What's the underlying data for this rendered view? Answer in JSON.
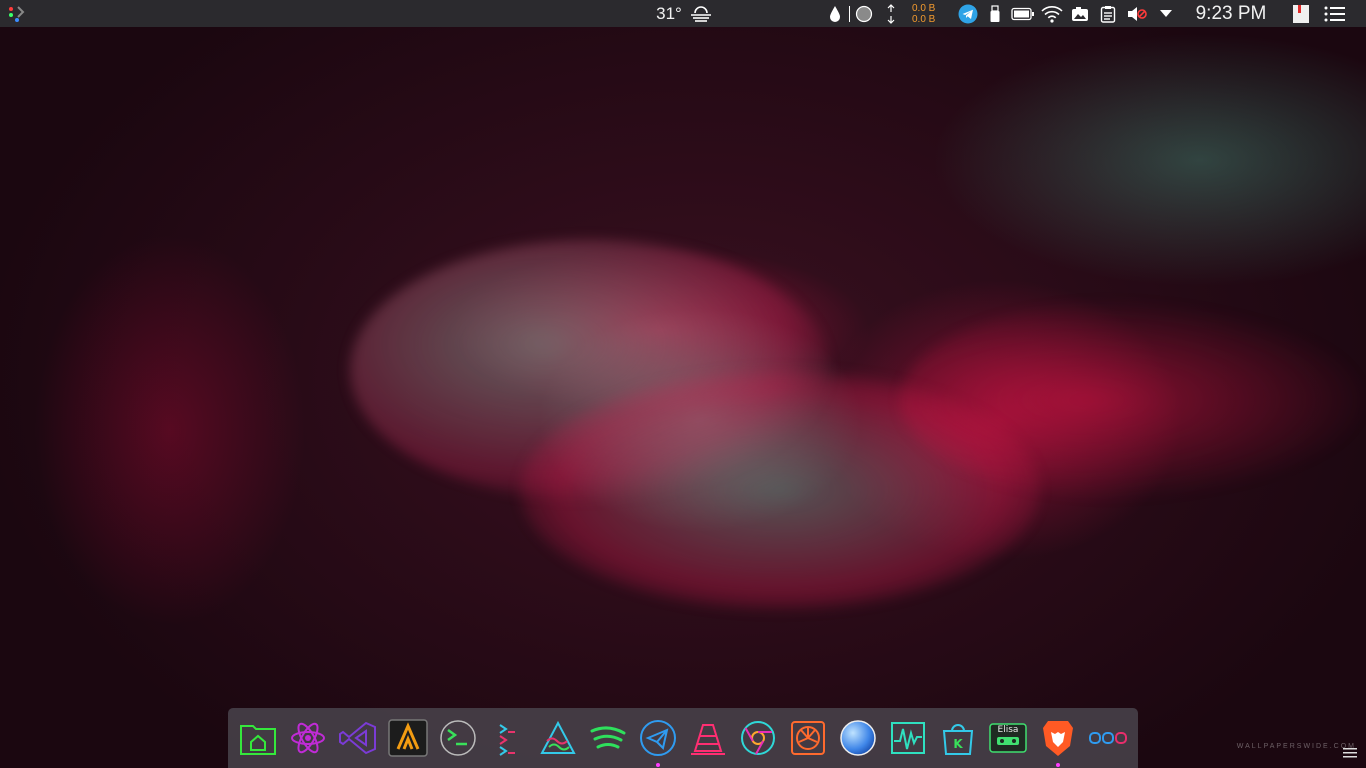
{
  "topbar": {
    "temperature": "31°",
    "net_up": "0.0 B",
    "net_down": "0.0 B",
    "clock": "9:23 PM",
    "icons": [
      "apps-launcher-icon",
      "weather-fog-icon",
      "droplet-icon",
      "record-icon",
      "network-arrows-icon",
      "telegram-icon",
      "usb-icon",
      "battery-icon",
      "wifi-icon",
      "screenshot-icon",
      "clipboard-icon",
      "volume-muted-icon",
      "dropdown-arrow-icon",
      "notes-icon",
      "menu-lines-icon"
    ]
  },
  "dock": {
    "apps": [
      {
        "name": "files",
        "icon": "home-folder-icon",
        "color": "#35e83c",
        "running": false
      },
      {
        "name": "atom",
        "icon": "atom-icon",
        "color": "#c02bd6",
        "running": false
      },
      {
        "name": "visual-studio",
        "icon": "visual-studio-icon",
        "color": "#7b3bd6",
        "running": false
      },
      {
        "name": "alacritty",
        "icon": "alacritty-icon",
        "color": "#f39c12",
        "running": false
      },
      {
        "name": "terminal",
        "icon": "terminal-icon",
        "color": "#39e05a",
        "running": false
      },
      {
        "name": "git",
        "icon": "git-icon",
        "color": "#e8336c",
        "running": false
      },
      {
        "name": "kdenlive",
        "icon": "wave-tent-icon",
        "color": "#33c9e8",
        "running": false
      },
      {
        "name": "spotify",
        "icon": "spotify-icon",
        "color": "#2ee05c",
        "running": false
      },
      {
        "name": "telegram",
        "icon": "telegram-icon",
        "color": "#2f9bf0",
        "running": true
      },
      {
        "name": "vlc",
        "icon": "vlc-cone-icon",
        "color": "#ff2e72",
        "running": false
      },
      {
        "name": "chromium",
        "icon": "chromium-icon",
        "color": "#2fd7d7",
        "running": false
      },
      {
        "name": "fan-control",
        "icon": "fan-icon",
        "color": "#ff6a2e",
        "running": false
      },
      {
        "name": "marble",
        "icon": "globe-icon",
        "color": "#2f7de8",
        "running": false
      },
      {
        "name": "system-monitor",
        "icon": "activity-monitor-icon",
        "color": "#2fe0c0",
        "running": false
      },
      {
        "name": "kde-store",
        "icon": "store-bag-icon",
        "color": "#33c9e8",
        "running": false
      },
      {
        "name": "elisa",
        "icon": "cassette-icon",
        "color": "#40e070",
        "running": false
      },
      {
        "name": "brave",
        "icon": "brave-lion-icon",
        "color": "#ff5a24",
        "running": true
      },
      {
        "name": "ooo",
        "icon": "ooo-icon",
        "color": "#2f9bf0",
        "running": false
      }
    ],
    "elisa_label": "Elisa"
  },
  "colors": {
    "accent_pink": "#ff3cff",
    "topbar_bg": "#2b2a2e",
    "net_orange": "#f29a2e"
  }
}
